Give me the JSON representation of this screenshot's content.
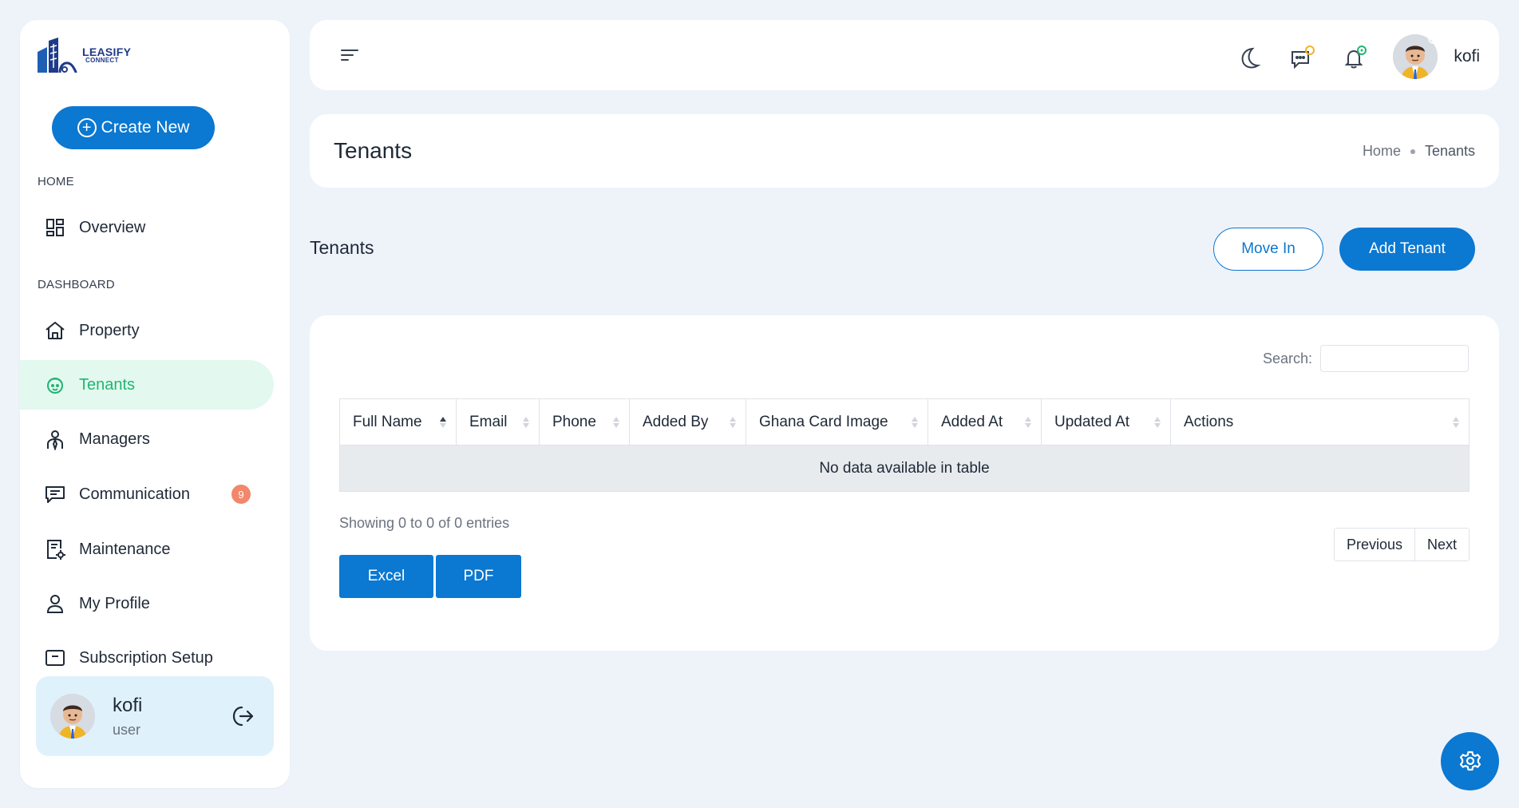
{
  "brand": {
    "line1": "LEASIFY",
    "line2": "CONNECT"
  },
  "sidebar": {
    "create_label": "Create New",
    "sections": {
      "home": "HOME",
      "dashboard": "DASHBOARD"
    },
    "items": [
      {
        "label": "Overview",
        "icon": "grid-icon"
      },
      {
        "label": "Property",
        "icon": "home-icon"
      },
      {
        "label": "Tenants",
        "icon": "tenant-face-icon",
        "active": true
      },
      {
        "label": "Managers",
        "icon": "manager-icon"
      },
      {
        "label": "Communication",
        "icon": "chat-icon",
        "badge": "9"
      },
      {
        "label": "Maintenance",
        "icon": "maintenance-icon"
      },
      {
        "label": "My Profile",
        "icon": "user-icon"
      },
      {
        "label": "Subscription Setup",
        "icon": "subscription-icon"
      }
    ],
    "user": {
      "name": "kofi",
      "role": "user"
    }
  },
  "topbar": {
    "username": "kofi"
  },
  "page": {
    "title": "Tenants",
    "breadcrumb": [
      "Home",
      "Tenants"
    ],
    "section_title": "Tenants",
    "move_in_label": "Move In",
    "add_tenant_label": "Add Tenant"
  },
  "table": {
    "search_label": "Search:",
    "columns": [
      "Full Name",
      "Email",
      "Phone",
      "Added By",
      "Ghana Card Image",
      "Added At",
      "Updated At",
      "Actions"
    ],
    "empty_text": "No data available in table",
    "info": "Showing 0 to 0 of 0 entries",
    "prev_label": "Previous",
    "next_label": "Next",
    "export": {
      "excel": "Excel",
      "pdf": "PDF"
    }
  },
  "colors": {
    "primary": "#0b78d1",
    "active_bg": "#e3f8ee",
    "active_text": "#22b573",
    "badge": "#f2876b"
  }
}
